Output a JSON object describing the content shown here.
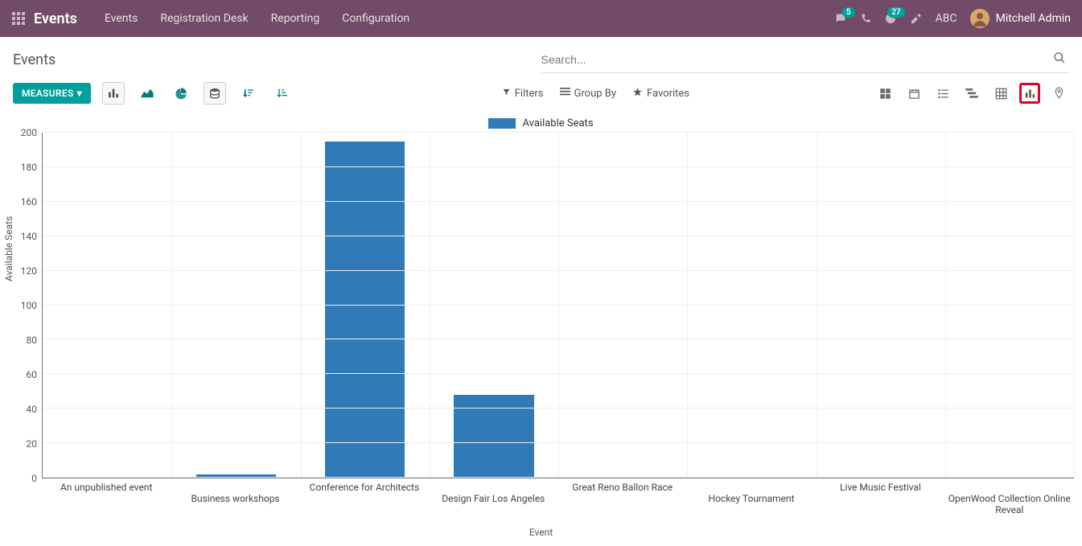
{
  "topnav": {
    "brand": "Events",
    "links": [
      "Events",
      "Registration Desk",
      "Reporting",
      "Configuration"
    ],
    "chat_badge": "5",
    "moon_badge": "27",
    "abc_label": "ABC",
    "user_name": "Mitchell Admin"
  },
  "panel": {
    "title": "Events",
    "search_placeholder": "Search...",
    "measures_label": "MEASURES",
    "filters_label": "Filters",
    "groupby_label": "Group By",
    "favorites_label": "Favorites"
  },
  "chart_data": {
    "type": "bar",
    "title": "",
    "xlabel": "Event",
    "ylabel": "Available Seats",
    "legend": "Available Seats",
    "categories": [
      "An unpublished event",
      "Business workshops",
      "Conference for Architects",
      "Design Fair Los Angeles",
      "Great Reno Ballon Race",
      "Hockey Tournament",
      "Live Music Festival",
      "OpenWood Collection Online Reveal"
    ],
    "values": [
      0,
      2,
      195,
      48,
      0,
      0,
      0,
      0
    ],
    "ylim": [
      0,
      200
    ],
    "y_ticks": [
      0,
      20,
      40,
      60,
      80,
      100,
      120,
      140,
      160,
      180,
      200
    ]
  },
  "colors": {
    "brand_bg": "#714b67",
    "teal": "#00a09d",
    "bar_blue": "#2f7ab7",
    "highlight_red": "#e4002b"
  }
}
